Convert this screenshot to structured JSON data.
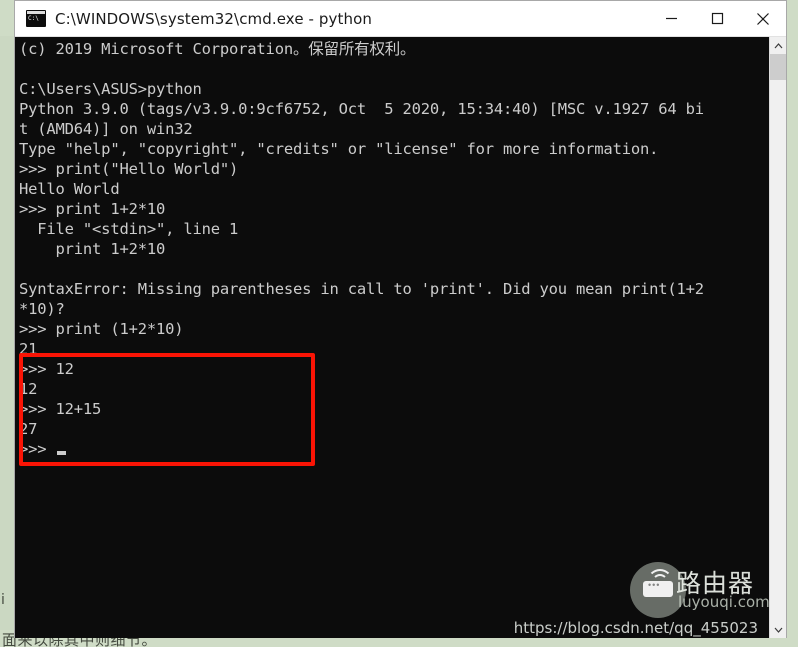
{
  "window": {
    "title": "C:\\WINDOWS\\system32\\cmd.exe - python",
    "icon": "cmd-console-icon",
    "controls": {
      "minimize": "minimize-icon",
      "maximize": "maximize-icon",
      "close": "close-icon"
    }
  },
  "console": {
    "background_color": "#0c0c0c",
    "text_color": "#cccccc",
    "lines": [
      "(c) 2019 Microsoft Corporation。保留所有权利。",
      "",
      "C:\\Users\\ASUS>python",
      "Python 3.9.0 (tags/v3.9.0:9cf6752, Oct  5 2020, 15:34:40) [MSC v.1927 64 bi",
      "t (AMD64)] on win32",
      "Type \"help\", \"copyright\", \"credits\" or \"license\" for more information.",
      ">>> print(\"Hello World\")",
      "Hello World",
      ">>> print 1+2*10",
      "  File \"<stdin>\", line 1",
      "    print 1+2*10",
      "",
      "SyntaxError: Missing parentheses in call to 'print'. Did you mean print(1+2",
      "*10)?",
      ">>> print (1+2*10)",
      "21",
      ">>> 12",
      "12",
      ">>> 12+15",
      "27",
      ">>> "
    ],
    "prompt": ">>>",
    "cursor": "block-cursor"
  },
  "annotation": {
    "color": "#fa1405",
    "label": "red-highlight-rectangle",
    "covers_lines": [
      ">>> 12",
      "12",
      ">>> 12+15",
      "27",
      ">>> "
    ]
  },
  "scrollbar": {
    "up_arrow": "chevron-up-icon",
    "down_arrow": "chevron-down-icon",
    "thumb": "scrollbar-thumb"
  },
  "watermark": {
    "title": "路由器",
    "subtitle": "luyouqi.com",
    "url": "https://blog.csdn.net/qq_455023",
    "icon": "router-signal-icon"
  },
  "desktop": {
    "background_color": "#cfdcc6",
    "bottom_text": "面来以除其中则细节。",
    "left_fragment": "i"
  }
}
